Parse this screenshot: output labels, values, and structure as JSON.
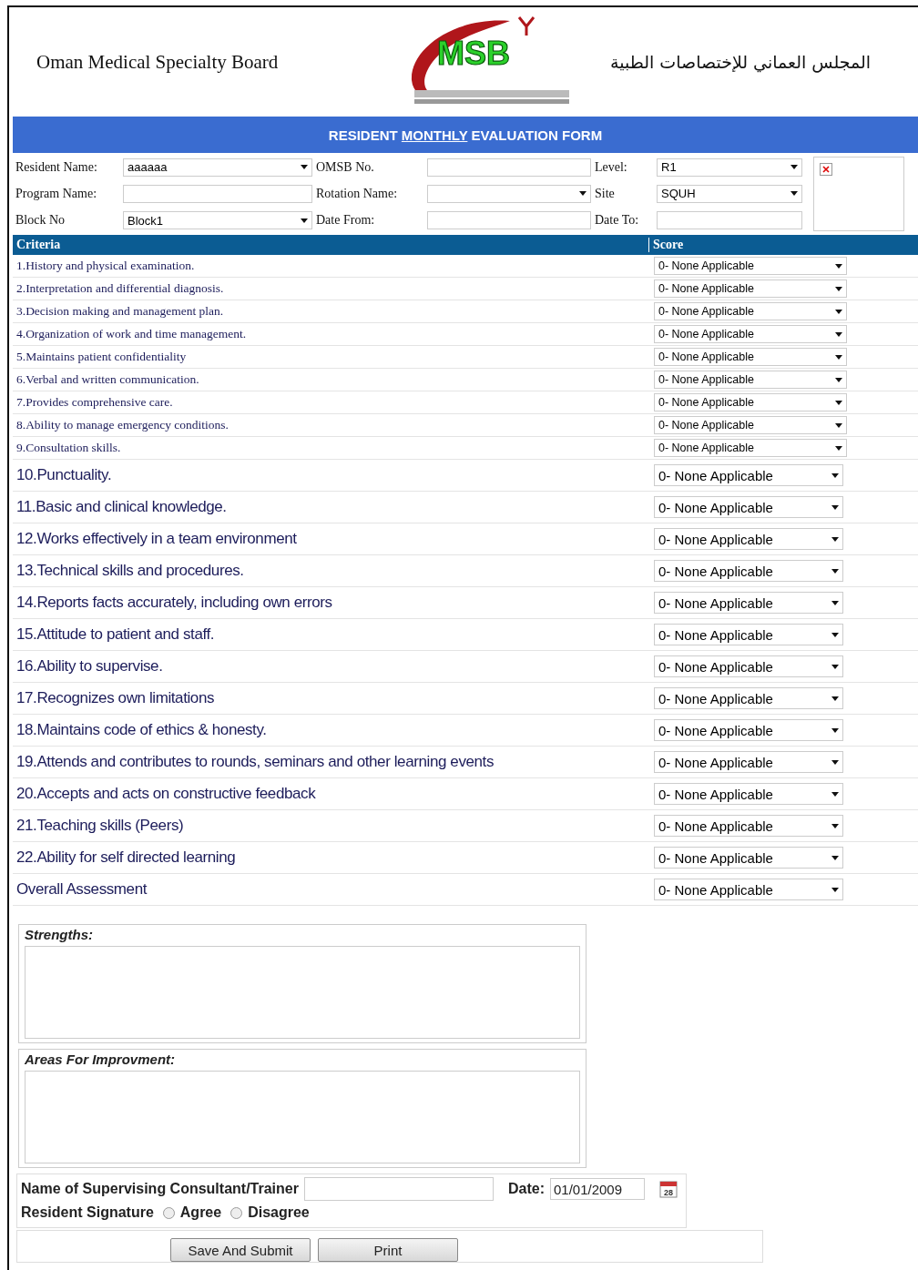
{
  "header": {
    "title_en": "Oman Medical Specialty Board",
    "logo_text": "MSB",
    "title_ar": "المجلس العماني للإختصاصات الطبية"
  },
  "form_title": {
    "before": "RESIDENT ",
    "underlined": "MONTHLY",
    "after": " EVALUATION FORM"
  },
  "fields": [
    [
      {
        "label": "Resident Name:",
        "kind": "select",
        "value": "aaaaaa"
      },
      {
        "label": "OMSB No.",
        "kind": "input"
      },
      {
        "label": "Level:",
        "kind": "select",
        "value": "R1"
      }
    ],
    [
      {
        "label": "Program Name:",
        "kind": "input"
      },
      {
        "label": "Rotation Name:",
        "kind": "select"
      },
      {
        "label": "Site",
        "kind": "select",
        "value": "SQUH"
      }
    ],
    [
      {
        "label": "Block No",
        "kind": "select",
        "value": "Block1"
      },
      {
        "label": "Date From:",
        "kind": "input"
      },
      {
        "label": "Date To:",
        "kind": "input"
      }
    ]
  ],
  "table": {
    "columns": [
      "Criteria",
      "Score"
    ],
    "rows": [
      {
        "criterion": "1.History and physical examination.",
        "score": "0- None Applicable",
        "kind": "small"
      },
      {
        "criterion": "2.Interpretation and differential diagnosis.",
        "score": "0- None Applicable",
        "kind": "small"
      },
      {
        "criterion": "3.Decision making and management plan.",
        "score": "0- None Applicable",
        "kind": "small"
      },
      {
        "criterion": "4.Organization of work and time management.",
        "score": "0- None Applicable",
        "kind": "small"
      },
      {
        "criterion": "5.Maintains patient confidentiality",
        "score": "0- None Applicable",
        "kind": "small"
      },
      {
        "criterion": "6.Verbal and written communication.",
        "score": "0- None Applicable",
        "kind": "small"
      },
      {
        "criterion": "7.Provides comprehensive care.",
        "score": "0- None Applicable",
        "kind": "small"
      },
      {
        "criterion": "8.Ability to manage emergency conditions.",
        "score": "0- None Applicable",
        "kind": "small"
      },
      {
        "criterion": "9.Consultation skills.",
        "score": "0- None Applicable",
        "kind": "small"
      },
      {
        "criterion": "10.Punctuality.",
        "score": "0- None Applicable",
        "kind": "large"
      },
      {
        "criterion": "11.Basic and clinical knowledge.",
        "score": "0- None Applicable",
        "kind": "large"
      },
      {
        "criterion": "12.Works effectively in a team environment",
        "score": "0- None Applicable",
        "kind": "large"
      },
      {
        "criterion": "13.Technical skills and procedures.",
        "score": "0- None Applicable",
        "kind": "large"
      },
      {
        "criterion": "14.Reports facts accurately, including own errors",
        "score": "0- None Applicable",
        "kind": "large"
      },
      {
        "criterion": "15.Attitude to patient and staff.",
        "score": "0- None Applicable",
        "kind": "large"
      },
      {
        "criterion": "16.Ability to supervise.",
        "score": "0- None Applicable",
        "kind": "large"
      },
      {
        "criterion": "17.Recognizes own limitations",
        "score": "0- None Applicable",
        "kind": "large"
      },
      {
        "criterion": "18.Maintains code of ethics & honesty.",
        "score": "0- None Applicable",
        "kind": "large"
      },
      {
        "criterion": "19.Attends and contributes to rounds, seminars and other learning events",
        "score": "0- None Applicable",
        "kind": "large"
      },
      {
        "criterion": "20.Accepts and acts on constructive feedback",
        "score": "0- None Applicable",
        "kind": "large"
      },
      {
        "criterion": "21.Teaching skills (Peers)",
        "score": "0- None Applicable",
        "kind": "large"
      },
      {
        "criterion": "22.Ability for self directed learning",
        "score": "0- None Applicable",
        "kind": "large"
      },
      {
        "criterion": "Overall Assessment",
        "score": "0- None Applicable",
        "kind": "large"
      }
    ]
  },
  "comments": [
    {
      "label": "Strengths:"
    },
    {
      "label": "Areas For Improvment:"
    }
  ],
  "supervisor": {
    "label": "Name of Supervising Consultant/Trainer",
    "date_label": "Date:",
    "date_value": "01/01/2009",
    "calendar_day": "28"
  },
  "signature": {
    "label": "Resident Signature",
    "options": [
      {
        "label": "Agree",
        "selected": false
      },
      {
        "label": "Disagree",
        "selected": false
      }
    ]
  },
  "buttons": [
    "Save And Submit",
    "Print"
  ]
}
